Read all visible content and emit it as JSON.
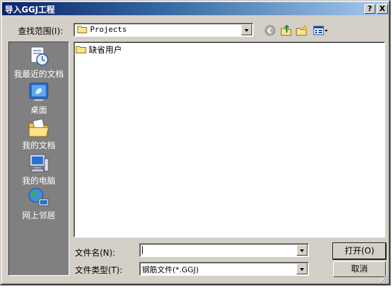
{
  "window": {
    "title": "导入GGJ工程"
  },
  "titlebar": {
    "help_label": "?",
    "close_label": "X"
  },
  "lookin": {
    "label": "查找范围(I):",
    "value": "Projects"
  },
  "places": [
    {
      "label": "我最近的文档",
      "icon": "recent-docs-icon"
    },
    {
      "label": "桌面",
      "icon": "desktop-icon"
    },
    {
      "label": "我的文档",
      "icon": "my-documents-icon"
    },
    {
      "label": "我的电脑",
      "icon": "my-computer-icon"
    },
    {
      "label": "网上邻居",
      "icon": "network-icon"
    }
  ],
  "files": [
    {
      "name": "缺省用户",
      "icon": "folder-icon"
    }
  ],
  "filename": {
    "label": "文件名(N):",
    "value": ""
  },
  "filetype": {
    "label": "文件类型(T):",
    "value": "钢筋文件(*.GGJ)"
  },
  "buttons": {
    "open": "打开(O)",
    "cancel": "取消"
  },
  "colors": {
    "title_start": "#0a246a",
    "title_end": "#a6caf0",
    "face": "#d4d0c8",
    "places_bg": "#808080"
  }
}
